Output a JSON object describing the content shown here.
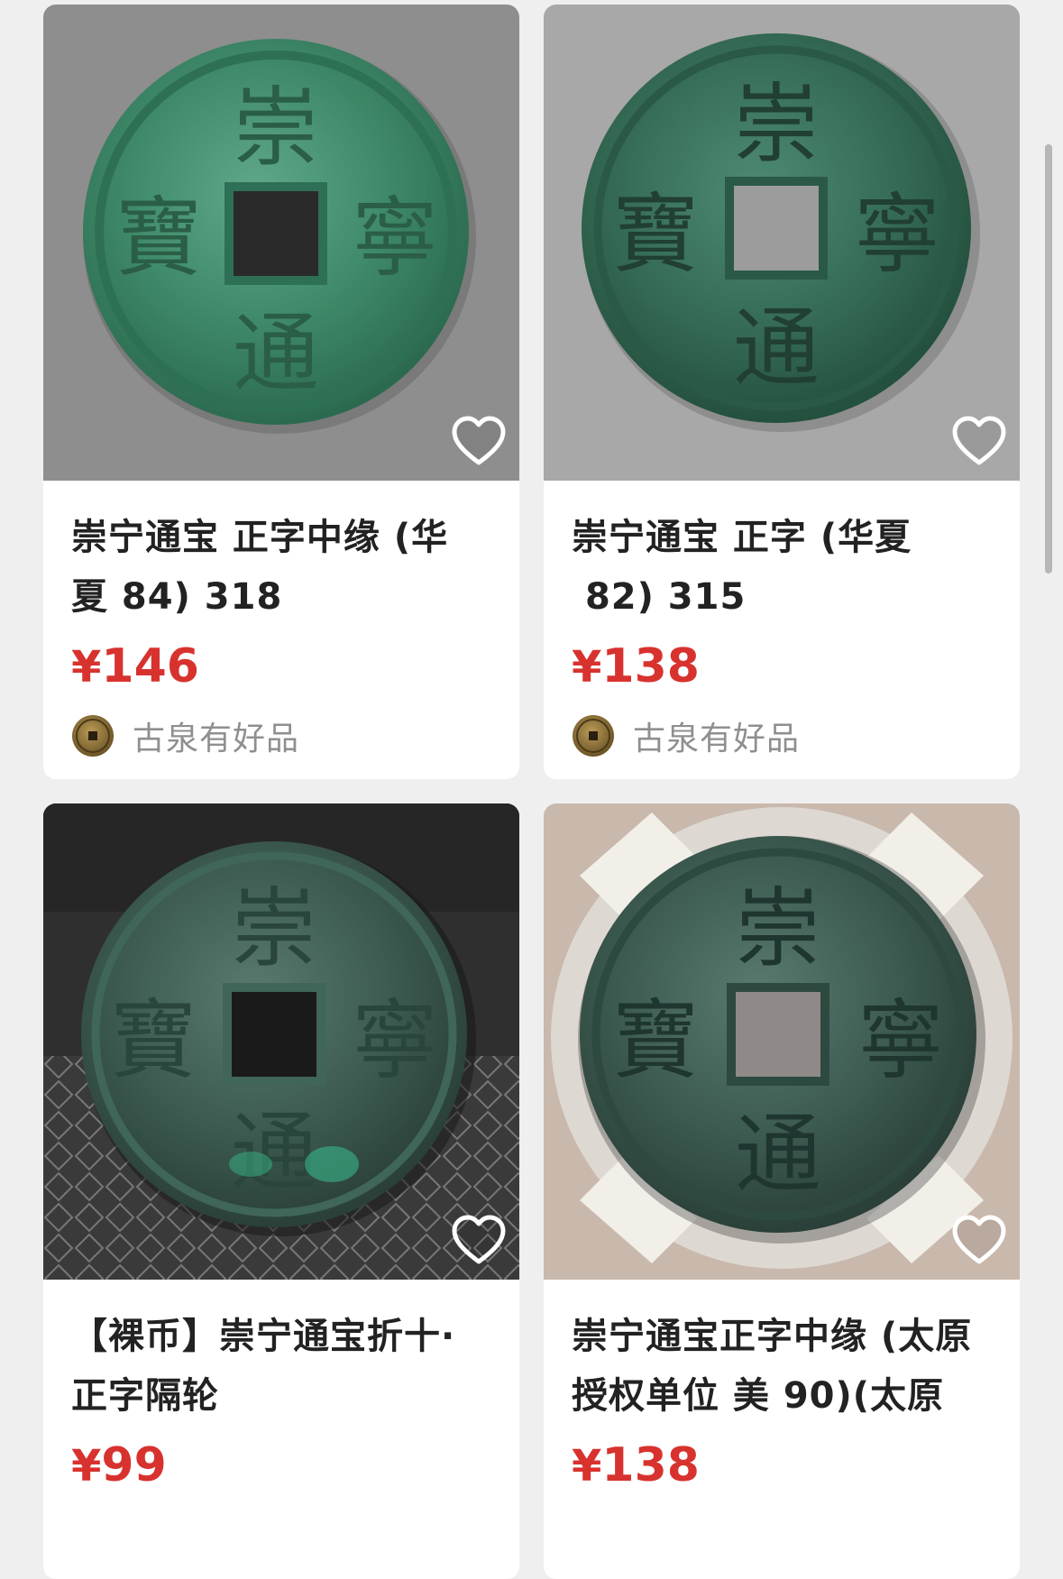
{
  "products": [
    {
      "title_line1": "崇宁通宝 正字中缘 (华",
      "title_line2": "夏 84) 318",
      "currency": "¥",
      "price": "146",
      "seller": "古泉有好品",
      "image": "green-coin-chongning-tongbao"
    },
    {
      "title_line1": "崇宁通宝 正字 (华夏",
      "title_line2": " 82) 315",
      "currency": "¥",
      "price": "138",
      "seller": "古泉有好品",
      "image": "green-coin-chongning-tongbao"
    },
    {
      "title_line1": "【裸币】崇宁通宝折十·",
      "title_line2": "正字隔轮",
      "currency": "¥",
      "price": "99",
      "seller": "",
      "image": "green-coin-on-grid-mat"
    },
    {
      "title_line1": "崇宁通宝正字中缘 (太原",
      "title_line2": "授权单位 美 90)(太原",
      "currency": "¥",
      "price": "138",
      "seller": "",
      "image": "slabbed-green-coin"
    }
  ],
  "icons": {
    "favorite": "heart-outline-icon",
    "seller_avatar": "coin-avatar-icon"
  },
  "colors": {
    "price": "#d8322f",
    "title": "#222222",
    "seller": "#8f8f8f",
    "background": "#efefef"
  }
}
